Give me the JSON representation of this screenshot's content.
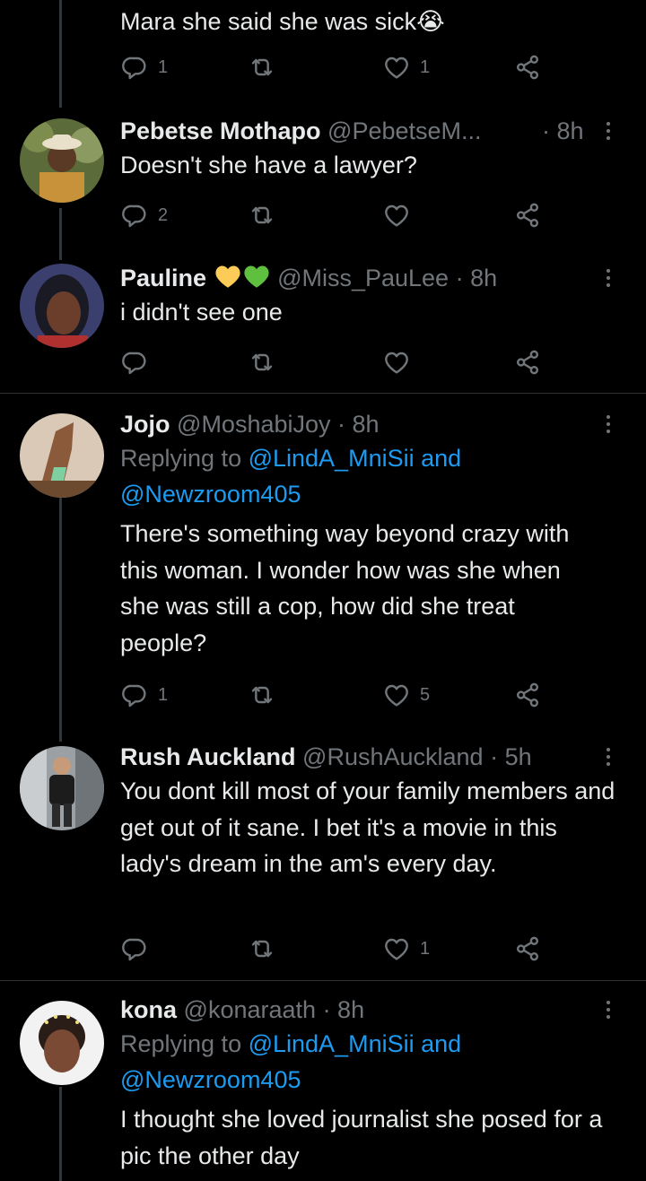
{
  "tweets": [
    {
      "body": "Mara she said she was sick😭",
      "replies": "1",
      "retweets": "",
      "likes": "1"
    },
    {
      "name": "Pebetse Mothapo",
      "handle": "@PebetseM...",
      "time": "· 8h",
      "body": "Doesn't she have a lawyer?",
      "replies": "2",
      "retweets": "",
      "likes": ""
    },
    {
      "name": "Pauline",
      "emoji": [
        "💛",
        "💚"
      ],
      "handle": "@Miss_PauLee",
      "time": "· 8h",
      "body": "i didn't see one",
      "replies": "",
      "retweets": "",
      "likes": ""
    },
    {
      "name": "Jojo",
      "handle": "@MoshabiJoy",
      "time": "· 8h",
      "replying_prefix": "Replying to ",
      "replying_mention1": "@LindA_MniSii and",
      "replying_mention2": "@Newzroom405",
      "body": "There's something way beyond crazy with this woman. I wonder how was she when she was still a cop, how did she treat people?",
      "replies": "1",
      "retweets": "",
      "likes": "5"
    },
    {
      "name": "Rush Auckland",
      "handle": "@RushAuckland",
      "time": "· 5h",
      "body": "You dont kill most of your family members and get out of it sane. I bet it's a movie in this lady's dream in the am's every day.",
      "replies": "",
      "retweets": "",
      "likes": "1"
    },
    {
      "name": "kona",
      "handle": "@konaraath",
      "time": "· 8h",
      "replying_prefix": "Replying to ",
      "replying_mention1": "@LindA_MniSii and",
      "replying_mention2": "@Newzroom405",
      "body": "I thought she loved journalist she posed for a pic the other day",
      "replies": "",
      "retweets": "",
      "likes": ""
    }
  ],
  "colors": {
    "background": "#000000",
    "text": "#e7e9ea",
    "muted": "#71767b",
    "link": "#1d9bf0",
    "divider": "#2f3336"
  },
  "icons": [
    "reply-icon",
    "retweet-icon",
    "like-icon",
    "share-icon",
    "more-icon"
  ]
}
